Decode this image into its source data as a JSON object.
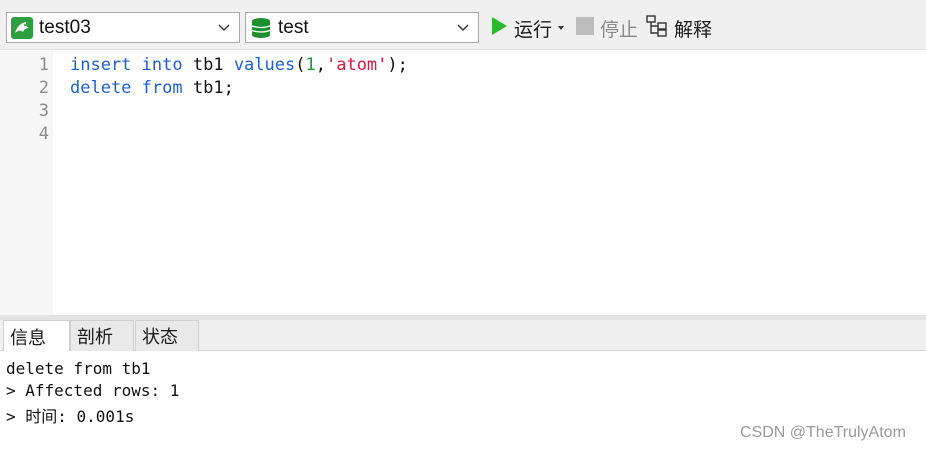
{
  "toolbar": {
    "connection": {
      "label": "test03",
      "icon": "mysql-connection-icon"
    },
    "database": {
      "label": "test",
      "icon": "database-icon"
    },
    "run_label": "运行",
    "stop_label": "停止",
    "explain_label": "解释"
  },
  "editor": {
    "line_numbers": [
      "1",
      "2",
      "3",
      "4"
    ],
    "lines": [
      [
        {
          "text": "insert",
          "kind": "kw"
        },
        {
          "text": " ",
          "kind": "plain"
        },
        {
          "text": "into",
          "kind": "kw"
        },
        {
          "text": " tb1 ",
          "kind": "plain"
        },
        {
          "text": "values",
          "kind": "kw"
        },
        {
          "text": "(",
          "kind": "plain"
        },
        {
          "text": "1",
          "kind": "num"
        },
        {
          "text": ",",
          "kind": "plain"
        },
        {
          "text": "'atom'",
          "kind": "str"
        },
        {
          "text": ");",
          "kind": "plain"
        }
      ],
      [
        {
          "text": "delete",
          "kind": "kw"
        },
        {
          "text": " ",
          "kind": "plain"
        },
        {
          "text": "from",
          "kind": "kw"
        },
        {
          "text": " tb1;",
          "kind": "plain"
        }
      ]
    ]
  },
  "result_tabs": [
    "信息",
    "剖析",
    "状态"
  ],
  "output": {
    "lines": [
      "delete from tb1",
      "> Affected rows: 1",
      "> 时间: 0.001s"
    ]
  },
  "watermark": "CSDN @TheTrulyAtom",
  "colors": {
    "keyword": "#1e5fd1",
    "number": "#1d9a3a",
    "string": "#d21b3e",
    "run_green": "#2eb82e",
    "db_green": "#1f8f2f"
  }
}
